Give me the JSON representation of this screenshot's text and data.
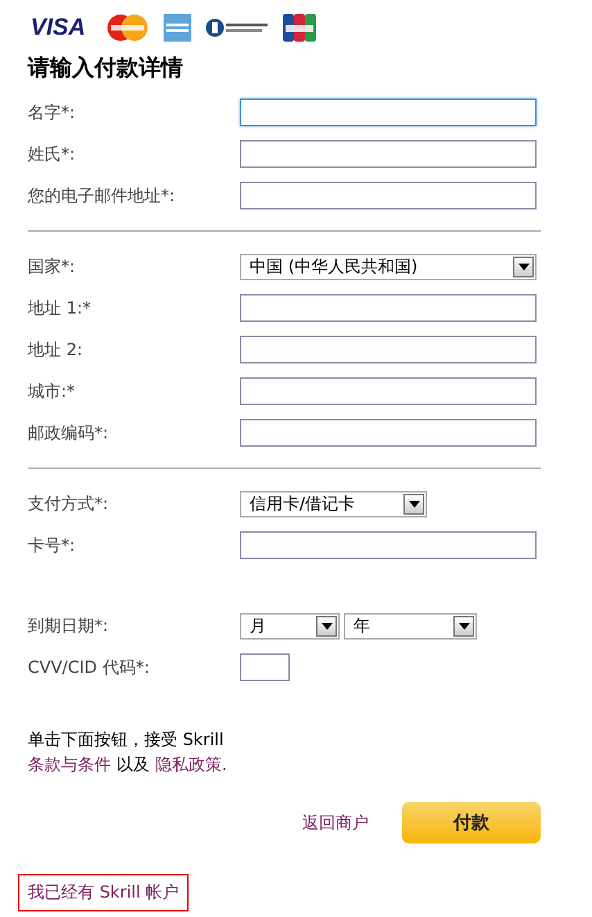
{
  "card_logos": [
    {
      "kind": "visa",
      "text": "VISA"
    },
    {
      "kind": "mastercard"
    },
    {
      "kind": "amex"
    },
    {
      "kind": "diners"
    },
    {
      "kind": "jcb"
    }
  ],
  "heading": "请输入付款详情",
  "sections": [
    {
      "divider": false,
      "fields": [
        {
          "kind": "input",
          "label": "名字*:",
          "focused": true
        },
        {
          "kind": "input",
          "label": "姓氏*:",
          "focused": false
        },
        {
          "kind": "input",
          "label": "您的电子邮件地址*:",
          "focused": false
        }
      ]
    },
    {
      "divider": true,
      "fields": [
        {
          "kind": "select",
          "label": "国家*:",
          "value": "中国 (中华人民共和国)"
        },
        {
          "kind": "input",
          "label": "地址 1:*",
          "focused": false
        },
        {
          "kind": "input",
          "label": "地址 2:",
          "focused": false
        },
        {
          "kind": "input",
          "label": "城市:*",
          "focused": false
        },
        {
          "kind": "input",
          "label": "邮政编码*:",
          "focused": false
        }
      ]
    },
    {
      "divider": true,
      "fields": [
        {
          "kind": "shortselect",
          "label": "支付方式*:",
          "value": "信用卡/借记卡"
        },
        {
          "kind": "input",
          "label": "卡号*:",
          "focused": false
        }
      ]
    },
    {
      "divider": false,
      "fields": [
        {
          "kind": "expiry",
          "label": "到期日期*:",
          "selects": [
            "月",
            "年"
          ]
        },
        {
          "kind": "cvv",
          "label": "CVV/CID 代码*:"
        }
      ]
    }
  ],
  "terms": {
    "text": "单击下面按钮，接受 Skrill",
    "link_terms": "条款与条件",
    "joiner": "以及",
    "link_privacy": "隐私政策",
    "end": "."
  },
  "back_link": "返回商户",
  "pay_button": "付款",
  "account_link": "我已经有 Skrill 帐户"
}
